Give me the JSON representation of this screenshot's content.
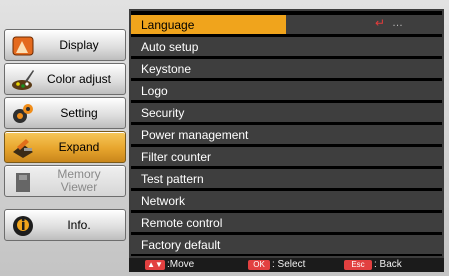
{
  "tabs": [
    {
      "label": "Display",
      "icon": "display-icon",
      "state": "normal"
    },
    {
      "label": "Color adjust",
      "icon": "paint-palette-icon",
      "state": "normal"
    },
    {
      "label": "Setting",
      "icon": "gears-icon",
      "state": "normal"
    },
    {
      "label": "Expand",
      "icon": "expand-tools-icon",
      "state": "active"
    },
    {
      "label": "Memory Viewer",
      "label_line1": "Memory",
      "label_line2": "Viewer",
      "icon": "memory-card-icon",
      "state": "disabled"
    },
    {
      "label": "Info.",
      "icon": "info-icon",
      "state": "normal"
    }
  ],
  "menu": {
    "items": [
      "Language",
      "Auto setup",
      "Keystone",
      "Logo",
      "Security",
      "Power management",
      "Filter counter",
      "Test pattern",
      "Network",
      "Remote control",
      "Factory default"
    ],
    "selected_index": 0,
    "selected_enter_symbol": "↵",
    "selected_dots": "…"
  },
  "footer": {
    "move_key": "▲▼",
    "move_label": ":Move",
    "select_key": "OK",
    "select_label": ": Select",
    "back_key": "Esc",
    "back_label": ": Back"
  },
  "colors": {
    "highlight": "#f0a41c",
    "active_tab": "#e7a52d",
    "panel_bg": "#3e3e3e",
    "key_red": "#e24040"
  }
}
